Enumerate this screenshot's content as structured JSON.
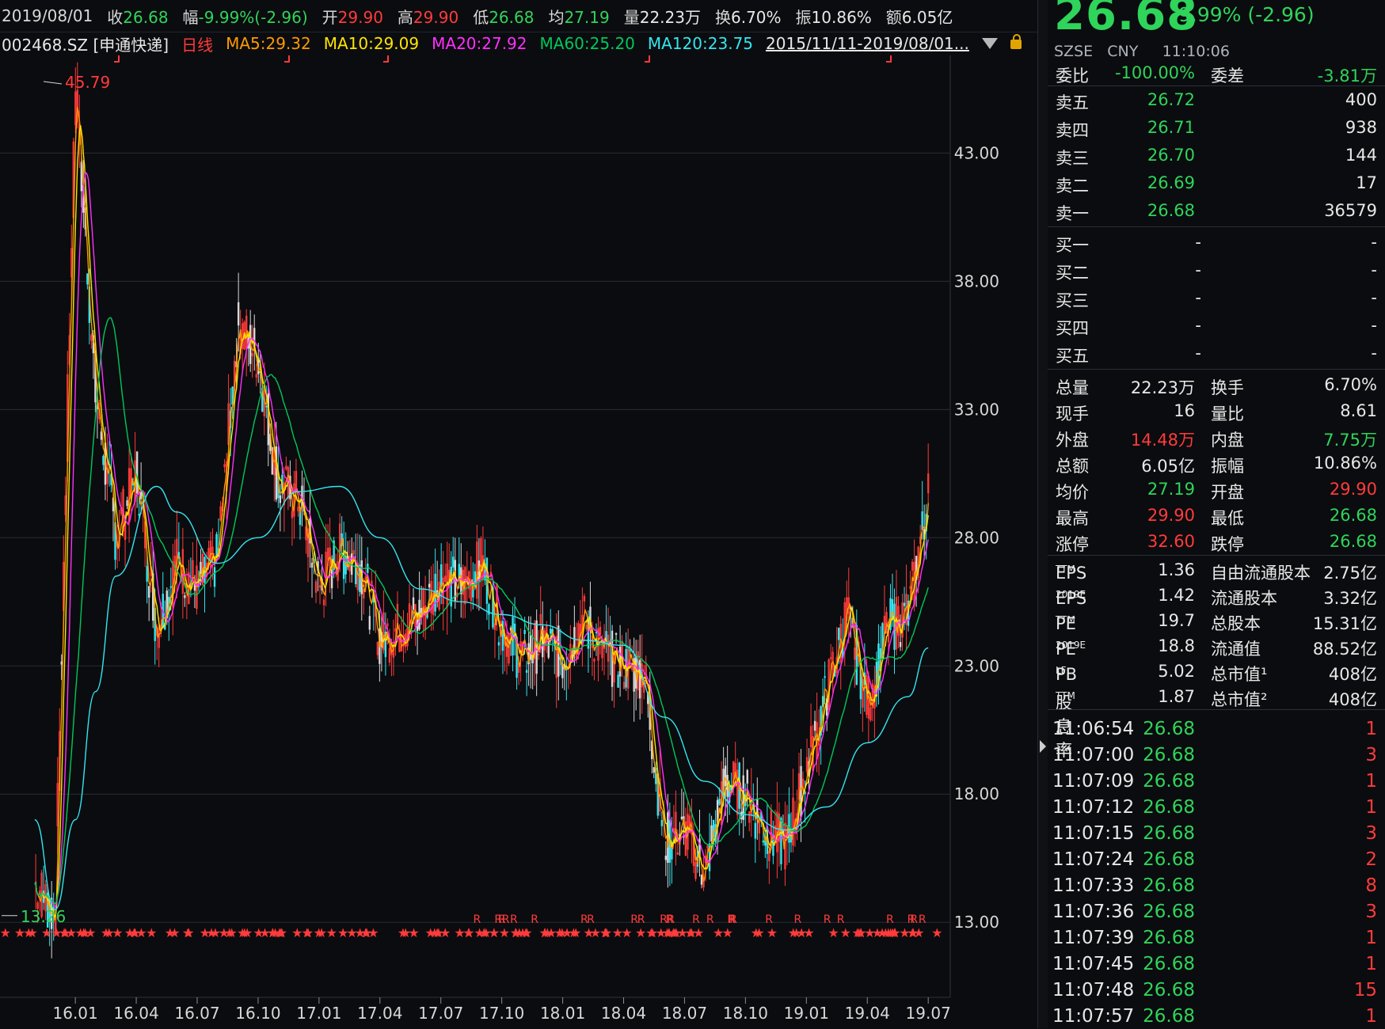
{
  "header": {
    "date": "2019/08/01",
    "close_label": "收",
    "close": "26.68",
    "chg_label": "幅",
    "chg": "-9.99%(-2.96)",
    "open_label": "开",
    "open": "29.90",
    "high_label": "高",
    "high": "29.90",
    "low_label": "低",
    "low": "26.68",
    "avg_label": "均",
    "avg": "27.19",
    "vol_label": "量",
    "vol": "22.23万",
    "turn_label": "换",
    "turn": "6.70%",
    "amp_label": "振",
    "amp": "10.86%",
    "amt_label": "额",
    "amt": "6.05亿"
  },
  "legend": {
    "symbol": "002468.SZ [申通快递]",
    "period": "日线",
    "ma5": "MA5:29.32",
    "ma10": "MA10:29.09",
    "ma20": "MA20:27.92",
    "ma60": "MA60:25.20",
    "ma120": "MA120:23.75",
    "range": "2015/11/11-2019/08/01..."
  },
  "colors": {
    "up": "#ff3b3b",
    "down": "#2fd45a",
    "ma5": "#ff9a00",
    "ma10": "#ffe400",
    "ma20": "#ff2fff",
    "ma60": "#00c85a",
    "ma120": "#33e7f1",
    "grid": "#2a2d33"
  },
  "chart_data": {
    "type": "candlestick",
    "y_ticks": [
      "43.00",
      "38.00",
      "33.00",
      "28.00",
      "23.00",
      "18.00",
      "13.00"
    ],
    "x_ticks": [
      "16.01",
      "16.04",
      "16.07",
      "16.10",
      "17.01",
      "17.04",
      "17.07",
      "17.10",
      "18.01",
      "18.04",
      "18.07",
      "18.10",
      "19.01",
      "19.04",
      "19.07"
    ],
    "ylim": [
      11,
      46.5
    ],
    "max_label": "45.79",
    "min_label": "13.26",
    "price_path": [
      [
        "2015-11",
        14.5
      ],
      [
        "2015-12",
        13.3
      ],
      [
        "2016-01",
        45.8
      ],
      [
        "2016-02",
        33.5
      ],
      [
        "2016-03",
        28.0
      ],
      [
        "2016-04",
        30.5
      ],
      [
        "2016-05",
        24.5
      ],
      [
        "2016-06",
        27.0
      ],
      [
        "2016-07",
        26.0
      ],
      [
        "2016-08",
        27.2
      ],
      [
        "2016-09",
        36.3
      ],
      [
        "2016-10",
        35.0
      ],
      [
        "2016-11",
        30.0
      ],
      [
        "2016-12",
        29.5
      ],
      [
        "2017-01",
        26.0
      ],
      [
        "2017-02",
        27.5
      ],
      [
        "2017-03",
        27.0
      ],
      [
        "2017-04",
        24.0
      ],
      [
        "2017-05",
        24.5
      ],
      [
        "2017-06",
        25.0
      ],
      [
        "2017-07",
        26.5
      ],
      [
        "2017-08",
        26.0
      ],
      [
        "2017-09",
        27.0
      ],
      [
        "2017-10",
        24.5
      ],
      [
        "2017-11",
        23.3
      ],
      [
        "2017-12",
        24.0
      ],
      [
        "2018-01",
        23.3
      ],
      [
        "2018-02",
        24.8
      ],
      [
        "2018-03",
        23.5
      ],
      [
        "2018-04",
        23.0
      ],
      [
        "2018-05",
        22.8
      ],
      [
        "2018-06",
        16.2
      ],
      [
        "2018-07",
        16.5
      ],
      [
        "2018-08",
        15.0
      ],
      [
        "2018-09",
        18.5
      ],
      [
        "2018-10",
        18.0
      ],
      [
        "2018-11",
        16.5
      ],
      [
        "2018-12",
        16.0
      ],
      [
        "2019-01",
        19.0
      ],
      [
        "2019-02",
        22.0
      ],
      [
        "2019-03",
        25.0
      ],
      [
        "2019-04",
        21.5
      ],
      [
        "2019-05",
        24.5
      ],
      [
        "2019-06",
        25.0
      ],
      [
        "2019-07",
        29.8
      ]
    ],
    "ma120_path": [
      [
        "2015-11",
        17.0
      ],
      [
        "2015-12",
        13.5
      ],
      [
        "2016-01",
        17.0
      ],
      [
        "2016-02",
        22.0
      ],
      [
        "2016-03",
        26.5
      ],
      [
        "2016-05",
        30.0
      ],
      [
        "2016-06",
        29.0
      ],
      [
        "2016-08",
        27.0
      ],
      [
        "2016-10",
        28.0
      ],
      [
        "2016-12",
        29.8
      ],
      [
        "2017-02",
        30.0
      ],
      [
        "2017-04",
        28.0
      ],
      [
        "2017-06",
        26.0
      ],
      [
        "2017-08",
        25.5
      ],
      [
        "2017-10",
        25.0
      ],
      [
        "2017-12",
        24.6
      ],
      [
        "2018-02",
        24.0
      ],
      [
        "2018-04",
        23.8
      ],
      [
        "2018-06",
        21.0
      ],
      [
        "2018-08",
        18.5
      ],
      [
        "2018-10",
        17.2
      ],
      [
        "2018-12",
        16.6
      ],
      [
        "2019-02",
        17.5
      ],
      [
        "2019-04",
        20.0
      ],
      [
        "2019-06",
        21.8
      ],
      [
        "2019-07",
        23.7
      ]
    ],
    "markers": "R ★"
  },
  "quote": {
    "price": "26.68",
    "change": "-9.99% (-2.96)",
    "exchange": "SZSE",
    "currency": "CNY",
    "time": "11:10:06",
    "weibi_label": "委比",
    "weibi": "-100.00%",
    "weicha_label": "委差",
    "weicha": "-3.81万",
    "asks": [
      {
        "label": "卖五",
        "price": "26.72",
        "vol": "400"
      },
      {
        "label": "卖四",
        "price": "26.71",
        "vol": "938"
      },
      {
        "label": "卖三",
        "price": "26.70",
        "vol": "144"
      },
      {
        "label": "卖二",
        "price": "26.69",
        "vol": "17"
      },
      {
        "label": "卖一",
        "price": "26.68",
        "vol": "36579"
      }
    ],
    "bids": [
      {
        "label": "买一",
        "price": "-",
        "vol": "-"
      },
      {
        "label": "买二",
        "price": "-",
        "vol": "-"
      },
      {
        "label": "买三",
        "price": "-",
        "vol": "-"
      },
      {
        "label": "买四",
        "price": "-",
        "vol": "-"
      },
      {
        "label": "买五",
        "price": "-",
        "vol": "-"
      }
    ],
    "stats": [
      {
        "l1": "总量",
        "v1": "22.23万",
        "c1": "w",
        "l2": "换手",
        "v2": "6.70%",
        "c2": "w"
      },
      {
        "l1": "现手",
        "v1": "16",
        "c1": "w",
        "l2": "量比",
        "v2": "8.61",
        "c2": "w"
      },
      {
        "l1": "外盘",
        "v1": "14.48万",
        "c1": "r",
        "l2": "内盘",
        "v2": "7.75万",
        "c2": "g"
      },
      {
        "l1": "总额",
        "v1": "6.05亿",
        "c1": "w",
        "l2": "振幅",
        "v2": "10.86%",
        "c2": "w"
      },
      {
        "l1": "均价",
        "v1": "27.19",
        "c1": "g",
        "l2": "开盘",
        "v2": "29.90",
        "c2": "r"
      },
      {
        "l1": "最高",
        "v1": "29.90",
        "c1": "r",
        "l2": "最低",
        "v2": "26.68",
        "c2": "g"
      },
      {
        "l1": "涨停",
        "v1": "32.60",
        "c1": "r",
        "l2": "跌停",
        "v2": "26.68",
        "c2": "g"
      }
    ],
    "fundamentals": [
      {
        "l1": "EPS",
        "s1": "TTM",
        "v1": "1.36",
        "l2": "自由流通股本",
        "v2": "2.75亿"
      },
      {
        "l1": "EPS",
        "s1": "2019E",
        "v1": "1.42",
        "l2": "流通股本",
        "v2": "3.32亿"
      },
      {
        "l1": "PE",
        "s1": "TTM",
        "v1": "19.7",
        "l2": "总股本",
        "v2": "15.31亿"
      },
      {
        "l1": "PE",
        "s1": "2019E",
        "v1": "18.8",
        "l2": "流通值",
        "v2": "88.52亿"
      },
      {
        "l1": "PB",
        "s1": "LF",
        "v1": "5.02",
        "l2": "总市值¹",
        "v2": "408亿"
      },
      {
        "l1": "股息率",
        "s1": "TTM",
        "v1": "1.87",
        "l2": "总市值²",
        "v2": "408亿"
      }
    ],
    "ticks": [
      {
        "time": "11:06:54",
        "price": "26.68",
        "vol": "1"
      },
      {
        "time": "11:07:00",
        "price": "26.68",
        "vol": "3"
      },
      {
        "time": "11:07:09",
        "price": "26.68",
        "vol": "1"
      },
      {
        "time": "11:07:12",
        "price": "26.68",
        "vol": "1"
      },
      {
        "time": "11:07:15",
        "price": "26.68",
        "vol": "3"
      },
      {
        "time": "11:07:24",
        "price": "26.68",
        "vol": "2"
      },
      {
        "time": "11:07:33",
        "price": "26.68",
        "vol": "8"
      },
      {
        "time": "11:07:36",
        "price": "26.68",
        "vol": "3"
      },
      {
        "time": "11:07:39",
        "price": "26.68",
        "vol": "1"
      },
      {
        "time": "11:07:45",
        "price": "26.68",
        "vol": "1"
      },
      {
        "time": "11:07:48",
        "price": "26.68",
        "vol": "15"
      },
      {
        "time": "11:07:57",
        "price": "26.68",
        "vol": "1"
      }
    ]
  }
}
